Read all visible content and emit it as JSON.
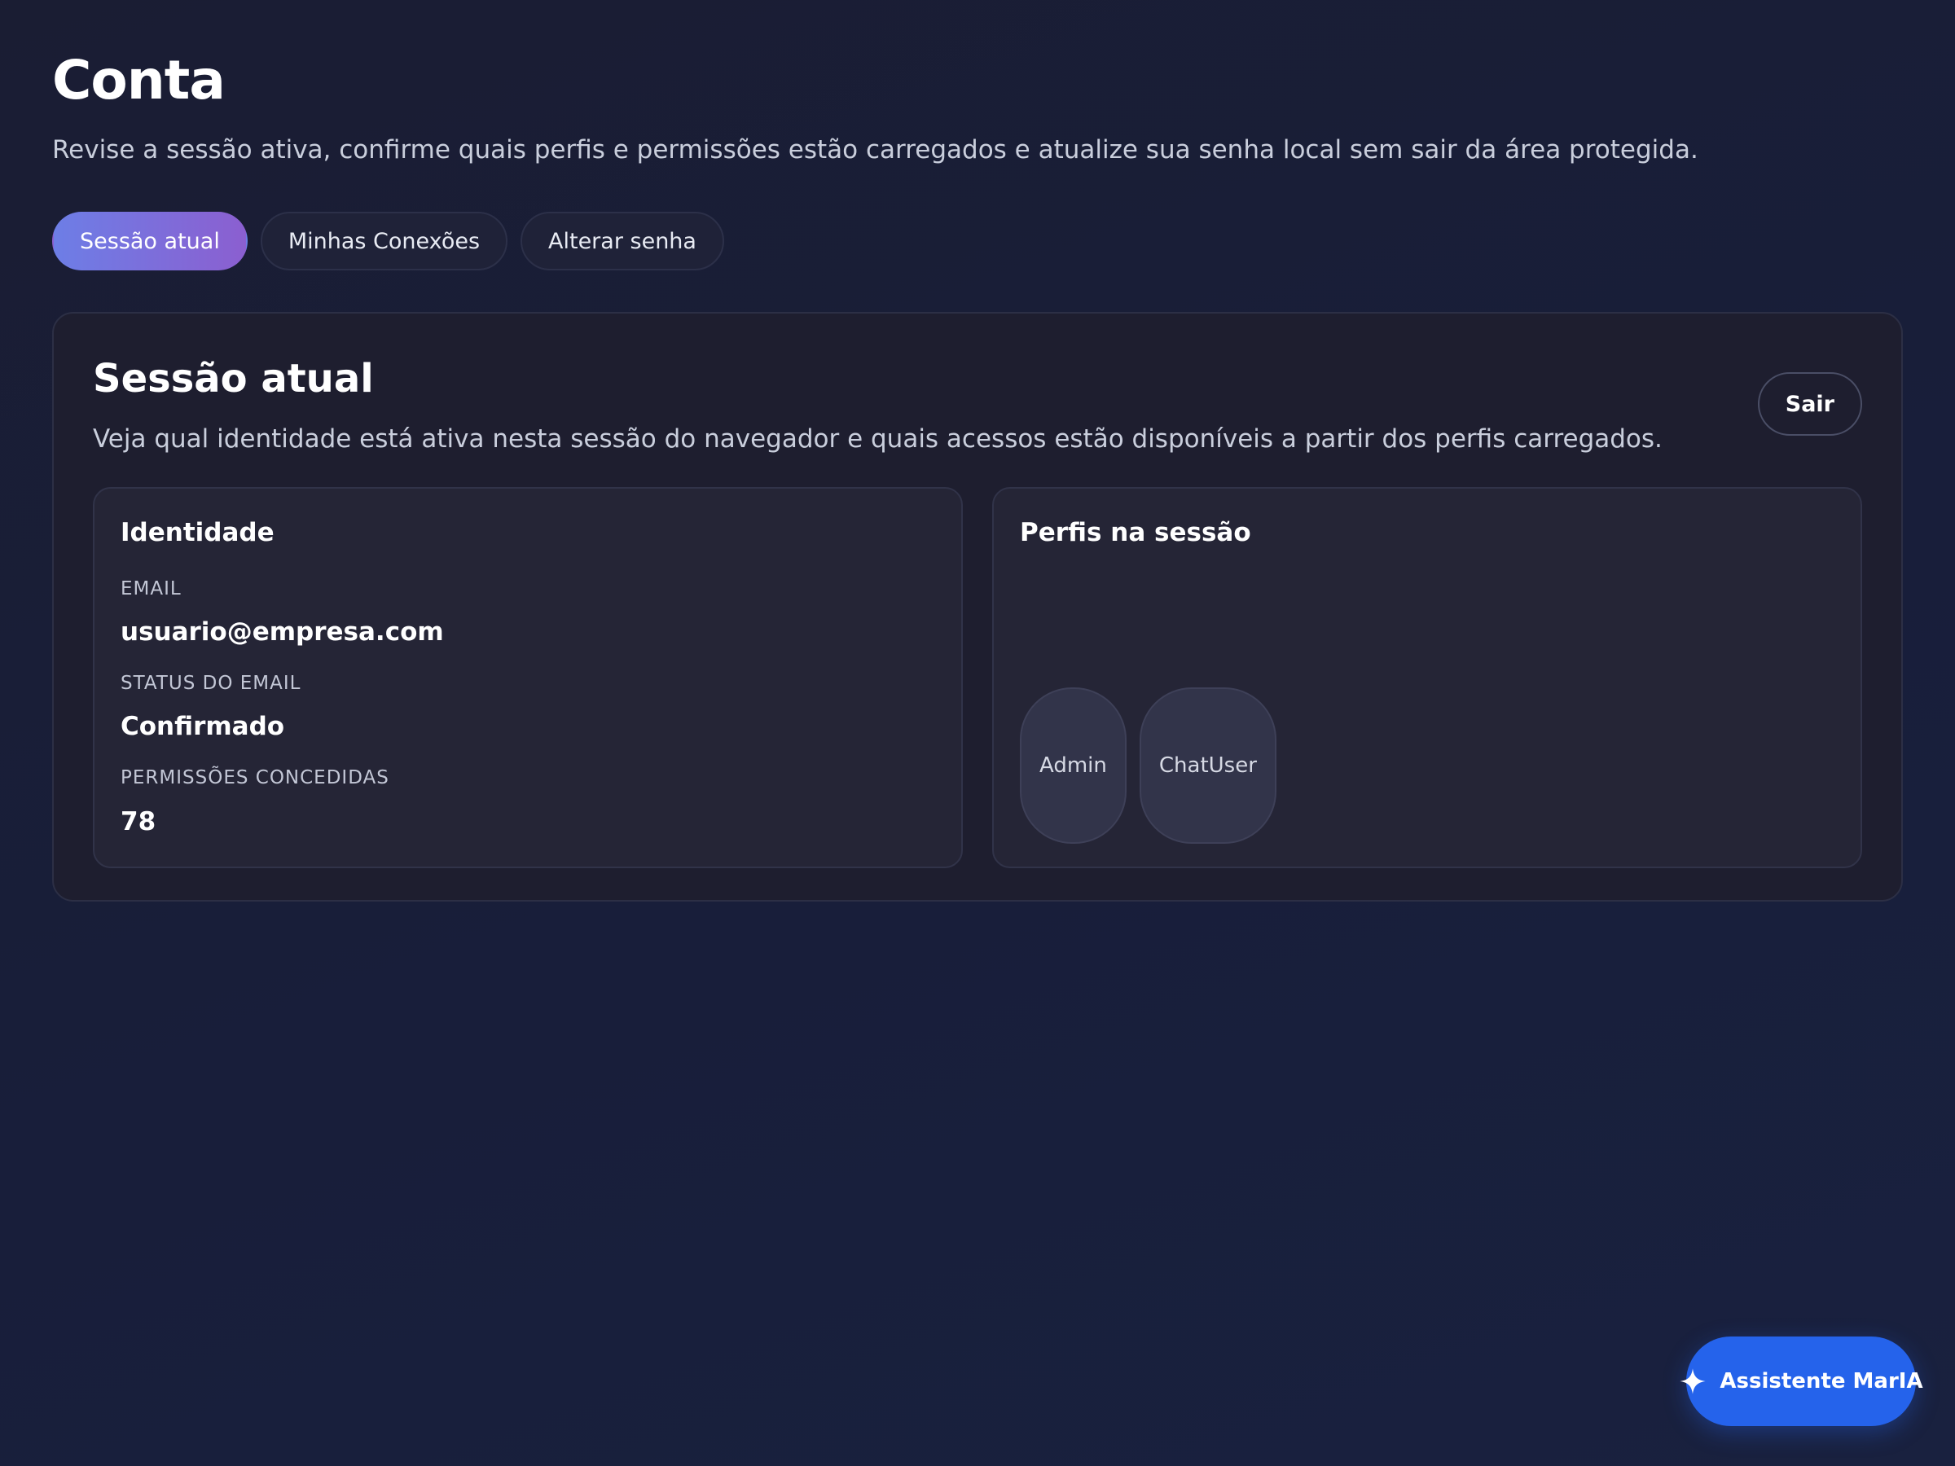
{
  "header": {
    "title": "Conta",
    "subtitle": "Revise a sessão ativa, confirme quais perfis e permissões estão carregados e atualize sua senha local sem sair da área protegida."
  },
  "tabs": [
    {
      "label": "Sessão atual",
      "active": true
    },
    {
      "label": "Minhas Conexões",
      "active": false
    },
    {
      "label": "Alterar senha",
      "active": false
    }
  ],
  "session": {
    "title": "Sessão atual",
    "description": "Veja qual identidade está ativa nesta sessão do navegador e quais acessos estão disponíveis a partir dos perfis carregados.",
    "logout_label": "Sair",
    "identity": {
      "title": "Identidade",
      "email_label": "EMAIL",
      "email_value": "usuario@empresa.com",
      "status_label": "STATUS DO EMAIL",
      "status_value": "Confirmado",
      "permissions_label": "PERMISSÕES CONCEDIDAS",
      "permissions_value": "78"
    },
    "profiles": {
      "title": "Perfis na sessão",
      "items": [
        "Admin",
        "ChatUser"
      ]
    }
  },
  "assistant": {
    "label": "Assistente MarIA",
    "icon": "sparkle-icon"
  },
  "colors": {
    "accent_gradient_start": "#6d7ee6",
    "accent_gradient_end": "#8b5fd0",
    "assistant_blue": "#2563eb",
    "background": "#1a1d33"
  }
}
